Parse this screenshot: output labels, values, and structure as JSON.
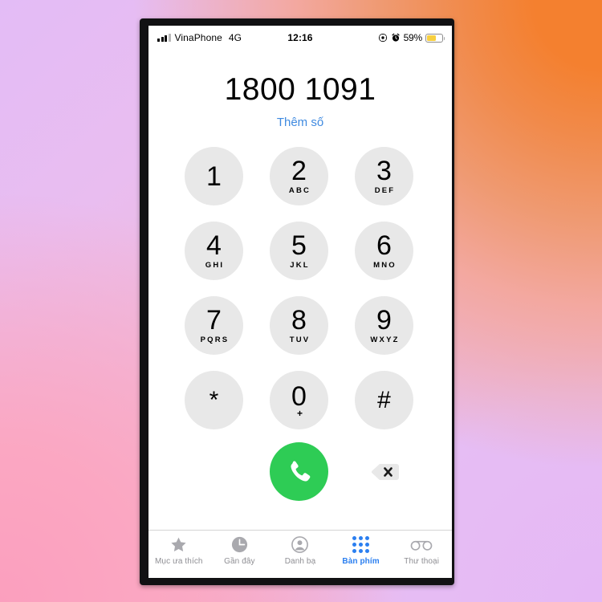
{
  "status_bar": {
    "signal_icon": "signal-bars-icon",
    "carrier": "VinaPhone",
    "network": "4G",
    "time": "12:16",
    "location_icon": "location-arrow-icon",
    "alarm_icon": "alarm-clock-icon",
    "battery_percent": "59%",
    "battery_icon": "battery-low-power-icon",
    "battery_color": "#f7cf3f"
  },
  "dialer": {
    "number": "1800 1091",
    "add_number_label": "Thêm số",
    "add_number_color": "#3f8ae0",
    "keys": [
      {
        "digit": "1",
        "letters": ""
      },
      {
        "digit": "2",
        "letters": "ABC"
      },
      {
        "digit": "3",
        "letters": "DEF"
      },
      {
        "digit": "4",
        "letters": "GHI"
      },
      {
        "digit": "5",
        "letters": "JKL"
      },
      {
        "digit": "6",
        "letters": "MNO"
      },
      {
        "digit": "7",
        "letters": "PQRS"
      },
      {
        "digit": "8",
        "letters": "TUV"
      },
      {
        "digit": "9",
        "letters": "WXYZ"
      },
      {
        "digit": "*",
        "letters": ""
      },
      {
        "digit": "0",
        "letters": "+"
      },
      {
        "digit": "#",
        "letters": ""
      }
    ],
    "call_button": {
      "icon": "phone-handset-icon",
      "color": "#2ecc55"
    },
    "delete_button": {
      "icon": "backspace-delete-icon"
    }
  },
  "tab_bar": {
    "active_color": "#2b7ff0",
    "inactive_color": "#8e8e93",
    "tabs": [
      {
        "label": "Mục ưa thích",
        "icon": "star-icon",
        "active": false
      },
      {
        "label": "Gần đây",
        "icon": "clock-icon",
        "active": false
      },
      {
        "label": "Danh bạ",
        "icon": "person-circle-icon",
        "active": false
      },
      {
        "label": "Bàn phím",
        "icon": "keypad-dots-icon",
        "active": true
      },
      {
        "label": "Thư thoại",
        "icon": "voicemail-icon",
        "active": false
      }
    ]
  }
}
